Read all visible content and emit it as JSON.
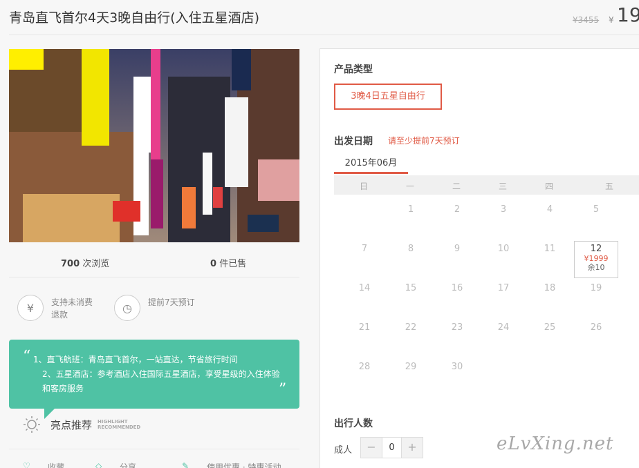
{
  "header": {
    "title": "青岛直飞首尔4天3晚自由行(入住五星酒店)",
    "price_old": "¥3455",
    "price_currency": "¥",
    "price_current": "19"
  },
  "stats": {
    "views_count": "700",
    "views_label": "次浏览",
    "sold_count": "0",
    "sold_label": "件已售"
  },
  "features": [
    {
      "icon": "yen-icon",
      "glyph": "¥",
      "text": "支持未消费退款"
    },
    {
      "icon": "clock-icon",
      "glyph": "◷",
      "text": "提前7天预订"
    }
  ],
  "highlights": {
    "line1": "1、直飞航班：青岛直飞首尔，一站直达，节省旅行时间",
    "line2": "2、五星酒店：参考酒店入住国际五星酒店，享受星级的入住体验和客房服务",
    "title": "亮点推荐",
    "subtitle_1": "HIGHLIGHT",
    "subtitle_2": "RECOMMENDED"
  },
  "bottom_actions": [
    {
      "label": "收藏"
    },
    {
      "label": "分享"
    },
    {
      "label": "使用优惠 · 特惠活动"
    }
  ],
  "panel": {
    "product_type_label": "产品类型",
    "product_type_option": "3晚4日五星自由行",
    "depart_label": "出发日期",
    "depart_hint": "请至少提前7天预订",
    "month": "2015年06月",
    "weekdays": [
      "日",
      "一",
      "二",
      "三",
      "四",
      "五"
    ],
    "weeks": [
      [
        "",
        "1",
        "2",
        "3",
        "4",
        "5"
      ],
      [
        "7",
        "8",
        "9",
        "10",
        "11",
        "12"
      ],
      [
        "14",
        "15",
        "16",
        "17",
        "18",
        "19"
      ],
      [
        "21",
        "22",
        "23",
        "24",
        "25",
        "26"
      ],
      [
        "28",
        "29",
        "30",
        "",
        "",
        ""
      ]
    ],
    "available_day": {
      "day": "12",
      "price": "¥1999",
      "stock": "余10"
    },
    "travelers_label": "出行人数",
    "adult_label": "成人",
    "adult_value": "0",
    "minus": "−",
    "plus": "+"
  },
  "watermark": "eLvXing.net"
}
